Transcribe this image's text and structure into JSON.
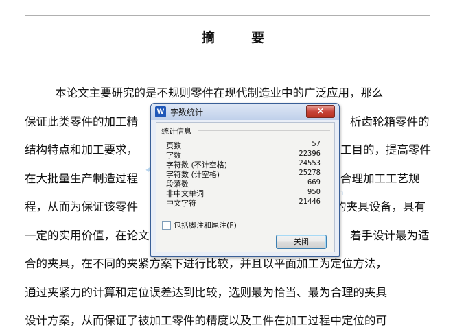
{
  "document": {
    "title_chars": [
      "摘",
      "要"
    ],
    "lines": [
      "本论文主要研究的是不规则零件在现代制造业中的广泛应用，那么",
      "保证此类零件的加工精",
      "析齿轮箱零件的",
      "结构特点和加工要求，",
      "工目的，提高零件",
      "在大批量生产制造过程",
      "合理加工工艺规",
      "程，从而为保证该零件",
      "的夹具设备，具有",
      "一定的实用价值，在论文",
      "着手设计最为适",
      "合的夹具，在不同的夹紧方案下进行比较，并且以平面加工为定位方法，",
      "通过夹紧力的计算和定位误差达到比较，选则最为恰当、最为合理的夹具",
      "设计方案，从而保证了被加工零件的精度以及工件在加工过程中定位的可"
    ]
  },
  "watermark": {
    "text": "人人文库",
    "url": "www.renrendoc.com"
  },
  "dialog": {
    "icon_letter": "W",
    "title": "字数统计",
    "close_symbol": "✕",
    "group_label": "统计信息",
    "stats": [
      {
        "label": "页数",
        "value": "57"
      },
      {
        "label": "字数",
        "value": "22396"
      },
      {
        "label": "字符数 (不计空格)",
        "value": "24553"
      },
      {
        "label": "字符数 (计空格)",
        "value": "25278"
      },
      {
        "label": "段落数",
        "value": "669"
      },
      {
        "label": "非中文单词",
        "value": "950"
      },
      {
        "label": "中文字符",
        "value": "21446"
      }
    ],
    "checkbox_label": "包括脚注和尾注(F)",
    "checkbox_checked": false,
    "close_button_label": "关闭"
  }
}
